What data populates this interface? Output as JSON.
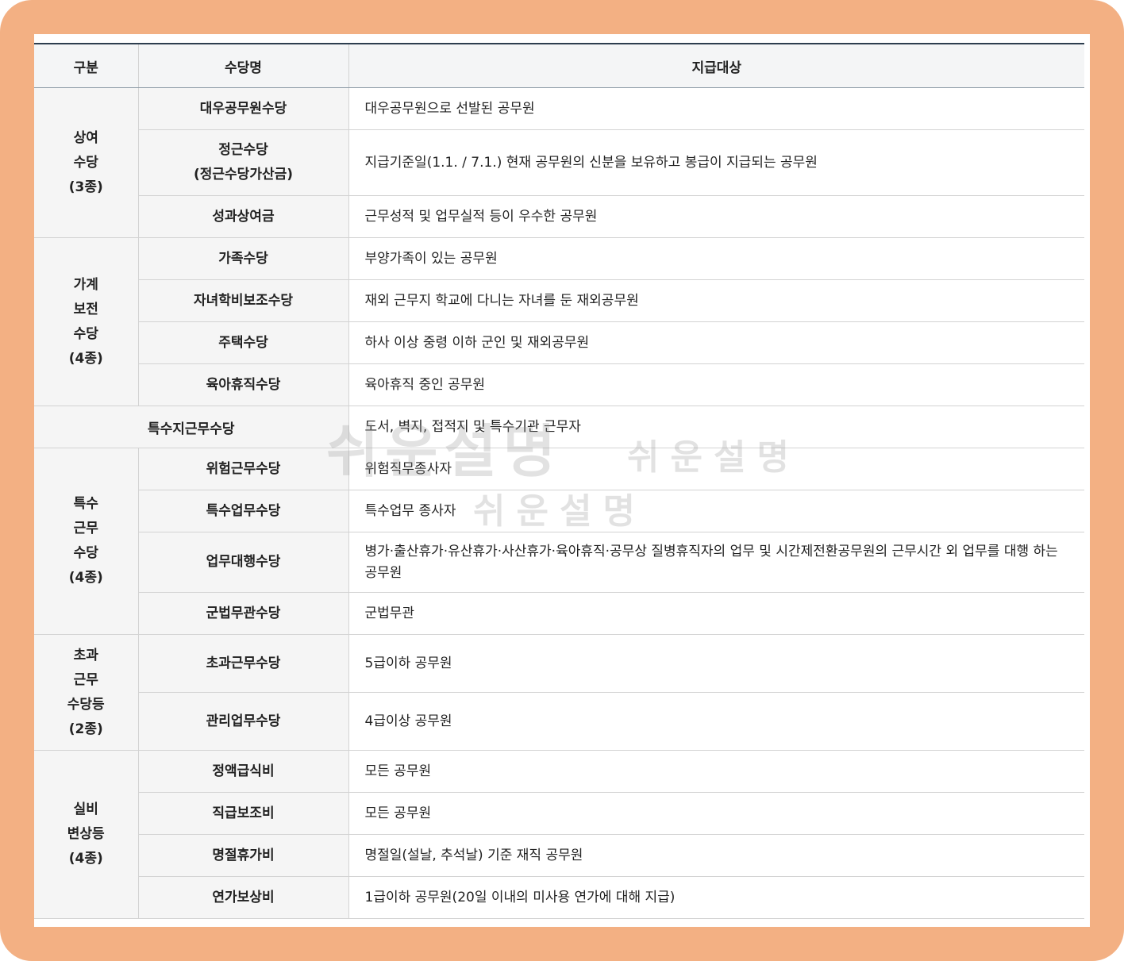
{
  "header": {
    "col_category": "구분",
    "col_name": "수당명",
    "col_target": "지급대상"
  },
  "rows": [
    {
      "cat_lines": [
        "상여",
        "수당",
        "(3종)"
      ],
      "name_lines": [
        "대우공무원수당"
      ],
      "target": "대우공무원으로 선발된 공무원"
    },
    {
      "name_lines": [
        "정근수당",
        "(정근수당가산금)"
      ],
      "target": "지급기준일(1.1. / 7.1.) 현재 공무원의 신분을 보유하고 봉급이 지급되는 공무원"
    },
    {
      "name_lines": [
        "성과상여금"
      ],
      "target": "근무성적 및 업무실적 등이 우수한 공무원"
    },
    {
      "cat_lines": [
        "가계",
        "보전",
        "수당",
        "(4종)"
      ],
      "name_lines": [
        "가족수당"
      ],
      "target": "부양가족이 있는 공무원"
    },
    {
      "name_lines": [
        "자녀학비보조수당"
      ],
      "target": "재외 근무지 학교에 다니는 자녀를 둔 재외공무원"
    },
    {
      "name_lines": [
        "주택수당"
      ],
      "target": "하사 이상 중령 이하 군인 및 재외공무원"
    },
    {
      "name_lines": [
        "육아휴직수당"
      ],
      "target": "육아휴직 중인 공무원"
    },
    {
      "merged_name": "특수지근무수당",
      "target": "도서, 벽지, 접적지 및 특수기관 근무자"
    },
    {
      "cat_lines": [
        "특수",
        "근무",
        "수당",
        "(4종)"
      ],
      "name_lines": [
        "위험근무수당"
      ],
      "target": "위험직무종사자"
    },
    {
      "name_lines": [
        "특수업무수당"
      ],
      "target": "특수업무 종사자"
    },
    {
      "name_lines": [
        "업무대행수당"
      ],
      "target": "병가·출산휴가·유산휴가·사산휴가·육아휴직·공무상 질병휴직자의 업무 및 시간제전환공무원의 근무시간 외 업무를 대행 하는 공무원"
    },
    {
      "name_lines": [
        "군법무관수당"
      ],
      "target": "군법무관"
    },
    {
      "cat_lines": [
        "초과",
        "근무",
        "수당등",
        "(2종)"
      ],
      "name_lines": [
        "초과근무수당"
      ],
      "target": "5급이하 공무원"
    },
    {
      "name_lines": [
        "관리업무수당"
      ],
      "target": "4급이상 공무원"
    },
    {
      "cat_lines": [
        "실비",
        "변상등",
        "(4종)"
      ],
      "name_lines": [
        "정액급식비"
      ],
      "target": "모든 공무원"
    },
    {
      "name_lines": [
        "직급보조비"
      ],
      "target": "모든 공무원"
    },
    {
      "name_lines": [
        "명절휴가비"
      ],
      "target": "명절일(설날, 추석날) 기준 재직 공무원"
    },
    {
      "name_lines": [
        "연가보상비"
      ],
      "target": "1급이하 공무원(20일 이내의 미사용 연가에 대해 지급)"
    }
  ],
  "watermark": {
    "text_large": "쉬운설명",
    "text_small_1": "쉬운설명",
    "text_small_2": "쉬운설명"
  },
  "colors": {
    "frame": "#f3b083",
    "header_top_border": "#2d3e4f",
    "cell_bg": "#f5f5f5",
    "grid": "#d3d3d3"
  }
}
